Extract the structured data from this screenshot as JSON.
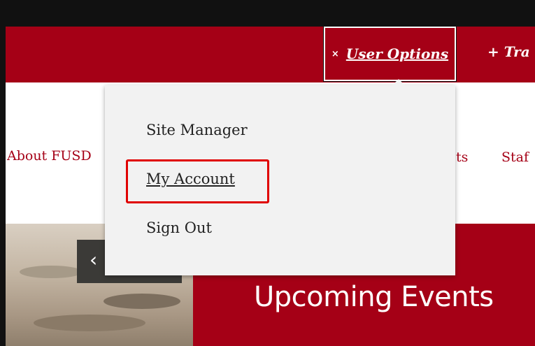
{
  "header": {
    "user_options": {
      "icon": "close-icon",
      "symbol": "×",
      "label": "User Options"
    },
    "next_menu": {
      "symbol": "+",
      "label": "Tra"
    }
  },
  "nav": {
    "items": [
      {
        "label": "About FUSD"
      },
      {
        "label": "ts"
      },
      {
        "label": "Staf"
      }
    ]
  },
  "dropdown": {
    "items": [
      {
        "label": "Site Manager"
      },
      {
        "label": "My Account"
      },
      {
        "label": "Sign Out"
      }
    ]
  },
  "hero": {
    "prev_symbol": "‹",
    "events_title": "Upcoming Events"
  },
  "colors": {
    "brand_red": "#a50016",
    "highlight": "#e00000",
    "dropdown_bg": "#f2f2f2"
  }
}
